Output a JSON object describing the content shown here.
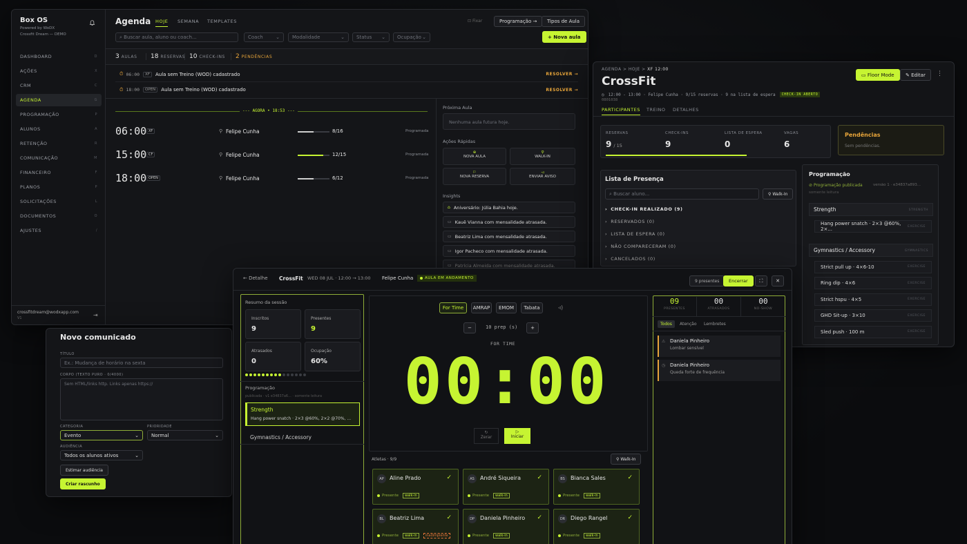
{
  "agenda": {
    "brand": "Box OS",
    "powered": "Powered by WoDX",
    "tenant": "Crossfit Dream — DEMO",
    "nav": [
      {
        "label": "DASHBOARD",
        "key": "D"
      },
      {
        "label": "AÇÕES",
        "key": "X"
      },
      {
        "label": "CRM",
        "key": "C"
      },
      {
        "label": "AGENDA",
        "key": "G"
      },
      {
        "label": "PROGRAMAÇÃO",
        "key": "P"
      },
      {
        "label": "ALUNOS",
        "key": "A"
      },
      {
        "label": "RETENÇÃO",
        "key": "R"
      },
      {
        "label": "COMUNICAÇÃO",
        "key": "M"
      },
      {
        "label": "FINANCEIRO",
        "key": "F"
      },
      {
        "label": "PLANOS",
        "key": "P"
      },
      {
        "label": "SOLICITAÇÕES",
        "key": "L"
      },
      {
        "label": "DOCUMENTOS",
        "key": "O"
      },
      {
        "label": "AJUSTES",
        "key": "/"
      }
    ],
    "user_email": "crossfitdream@wodxapp.com",
    "user_sub": "V1",
    "title": "Agenda",
    "tabs": [
      "HOJE",
      "SEMANA",
      "TEMPLATES"
    ],
    "fixar": "Fixar",
    "prog_btn": "Programação →",
    "tipos_btn": "Tipos de Aula",
    "search_ph": "Buscar aula, aluno ou coach...",
    "filters": [
      "Coach",
      "Modalidade",
      "Status",
      "Ocupação"
    ],
    "new_btn": "+ Nova aula",
    "stats": [
      {
        "n": "3",
        "l": "AULAS"
      },
      {
        "n": "18",
        "l": "RESERVAS"
      },
      {
        "n": "10",
        "l": "CHECK-INS"
      },
      {
        "n": "2",
        "l": "PENDÊNCIAS"
      }
    ],
    "pending": [
      {
        "time": "06:00",
        "tag": "XF",
        "text": "Aula sem Treino (WOD) cadastrado",
        "action": "RESOLVER →"
      },
      {
        "time": "18:00",
        "tag": "OPEN",
        "text": "Aula sem Treino (WOD) cadastrado",
        "action": "RESOLVER →"
      }
    ],
    "now": "--- AGORA • 18:53 ---",
    "classes": [
      {
        "time": "06:00",
        "tag": "XF",
        "coach": "Felipe Cunha",
        "occ": "8/16",
        "frac": 0.5,
        "status": "Programada"
      },
      {
        "time": "15:00",
        "tag": "CF",
        "coach": "Felipe Cunha",
        "occ": "12/15",
        "frac": 0.8,
        "status": "Programada"
      },
      {
        "time": "18:00",
        "tag": "OPEN",
        "coach": "Felipe Cunha",
        "occ": "6/12",
        "frac": 0.5,
        "status": "Programada"
      }
    ],
    "next_title": "Próxima Aula",
    "next_empty": "Nenhuma aula futura hoje.",
    "quick_title": "Ações Rápidas",
    "quick": [
      "NOVA AULA",
      "WALK-IN",
      "NOVA RESERVA",
      "ENVIAR AVISO"
    ],
    "insights_title": "Insights",
    "insights": [
      "Aniversário: Júlia Bahia hoje.",
      "Kauê Vianna com mensalidade atrasada.",
      "Beatriz Lima com mensalidade atrasada.",
      "Igor Pacheco com mensalidade atrasada.",
      "Patrícia Almeida com mensalidade atrasada."
    ]
  },
  "cls": {
    "crumb": [
      "AGENDA",
      ">",
      "HOJE",
      ">",
      "XF 12:00"
    ],
    "title": "CrossFit",
    "floor": "Floor Mode",
    "edit": "Editar",
    "meta": "12:00 - 13:00  ·  Felipe Cunha  ·  9/15 reservas  ·  9 na lista de espera",
    "badge": "CHECK-IN ABERTO",
    "code": "0801038",
    "tabs": [
      "PARTICIPANTES",
      "TREINO",
      "DETALHES"
    ],
    "kpis": [
      {
        "l": "RESERVAS",
        "v": "9",
        "s": "/ 15"
      },
      {
        "l": "CHECK-INS",
        "v": "9",
        "s": ""
      },
      {
        "l": "LISTA DE ESPERA",
        "v": "0",
        "s": ""
      },
      {
        "l": "VAGAS",
        "v": "6",
        "s": ""
      }
    ],
    "pend_title": "Pendências",
    "pend_text": "Sem pendências.",
    "list_title": "Lista de Presença",
    "list_search": "Buscar aluno...",
    "walkin": "Walk-In",
    "groups": [
      "CHECK-IN REALIZADO (9)",
      "RESERVADOS (0)",
      "LISTA DE ESPERA (0)",
      "NÃO COMPARECERAM (0)",
      "CANCELADOS (0)"
    ],
    "prog_title": "Programação",
    "prog_pub": "Programação publicada",
    "prog_ver": "versão 1 · e34837a893...",
    "prog_mode": "somente leitura",
    "sections": [
      {
        "name": "Strength",
        "tag": "STRENGTH",
        "items": [
          "Hang power snatch · 2×3 @60%, 2×..."
        ]
      },
      {
        "name": "Gymnastics / Accessory",
        "tag": "GYMNASTICS",
        "items": [
          "Strict pull up · 4×6-10",
          "Ring dip · 4×6",
          "Strict hspu · 4×5",
          "GHD Sit-up · 3×10",
          "Sled push · 100 m"
        ]
      }
    ],
    "ex_tag": "EXERCISE"
  },
  "comm": {
    "title": "Novo comunicado",
    "titulo_l": "TÍTULO",
    "titulo_ph": "Ex.: Mudança de horário na sexta",
    "corpo_l": "CORPO (TEXTO PURO · 0/4000)",
    "corpo_ph": "Sem HTML/links http. Links apenas https://",
    "cat_l": "CATEGORIA",
    "cat_v": "Evento",
    "prio_l": "PRIORIDADE",
    "prio_v": "Normal",
    "aud_l": "AUDIÊNCIA",
    "aud_v": "Todos os alunos ativos",
    "est": "Estimar audiência",
    "create": "Criar rascunho"
  },
  "live": {
    "back": "← Detalhe",
    "class": "CrossFit",
    "date": "WED 08 JUL · 12:00 → 13:00",
    "coach": "Felipe Cunha",
    "status": "AULA EM ANDAMENTO",
    "present_chip": "9 presentes",
    "end": "Encerrar",
    "summary_title": "Resumo da sessão",
    "summary": [
      {
        "l": "Inscritos",
        "v": "9"
      },
      {
        "l": "Presentes",
        "v": "9"
      },
      {
        "l": "Atrasados",
        "v": "0"
      },
      {
        "l": "Ocupação",
        "v": "60%"
      }
    ],
    "prog_title": "Programação",
    "prog_meta": "publicada · v1 e34837a6... · somente leitura",
    "strength": "Strength",
    "strength_desc": "Hang power snatch · 2×3 @60%, 2×2 @70%, ...",
    "gym": "Gymnastics / Accessory",
    "modes": [
      "For Time",
      "AMRAP",
      "EMOM",
      "Tabata"
    ],
    "prep": "10 prep (s)",
    "mode_label": "FOR TIME",
    "clock": "00:00",
    "reset": "Zerar",
    "start": "Iniciar",
    "athletes_title": "Atletas · 9/9",
    "walkin": "Walk-In",
    "athletes": [
      {
        "ini": "AP",
        "name": "Aline Prado",
        "st": "Presente",
        "tag": "walk-in"
      },
      {
        "ini": "AS",
        "name": "André Siqueira",
        "st": "Presente",
        "tag": "walk-in"
      },
      {
        "ini": "BS",
        "name": "Bianca Sales",
        "st": "Presente",
        "tag": "walk-in"
      },
      {
        "ini": "BL",
        "name": "Beatriz Lima",
        "st": "Presente",
        "tag": "walk-in",
        "tag2": "inadimplente"
      },
      {
        "ini": "DP",
        "name": "Daniela Pinheiro",
        "st": "Presente",
        "tag": "walk-in"
      },
      {
        "ini": "DR",
        "name": "Diego Rangel",
        "st": "Presente",
        "tag": "walk-in"
      }
    ],
    "counters": [
      {
        "v": "09",
        "l": "PRESENTES"
      },
      {
        "v": "00",
        "l": "ATRASADOS"
      },
      {
        "v": "00",
        "l": "NO-SHOW"
      }
    ],
    "alert_tabs": [
      "Todos",
      "Atenção",
      "Lembretes"
    ],
    "alerts": [
      {
        "name": "Daniela Pinheiro",
        "text": "Lombar sensível"
      },
      {
        "name": "Daniela Pinheiro",
        "text": "Queda forte de frequência"
      }
    ]
  }
}
